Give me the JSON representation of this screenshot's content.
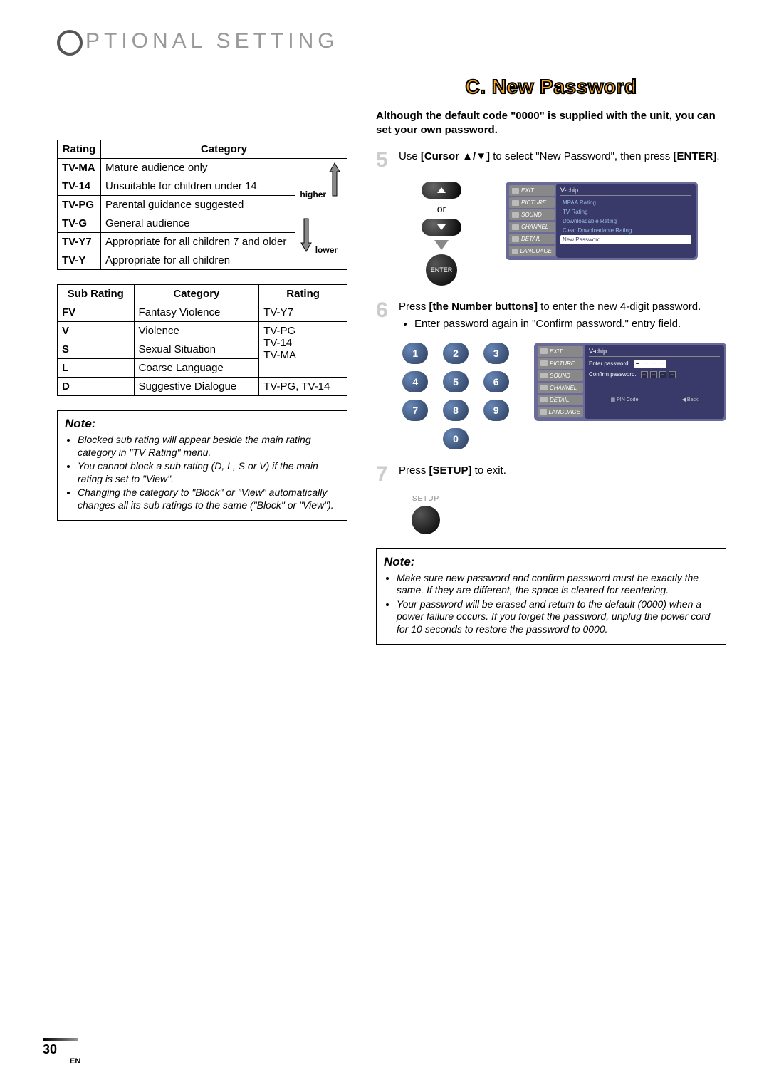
{
  "page_title": "PTIONAL SETTING",
  "section_header": "C. New Password",
  "intro": "Although the default code \"0000\" is supplied with the unit, you can set your own password.",
  "rating_table": {
    "headers": [
      "Rating",
      "Category"
    ],
    "higher": "higher",
    "lower": "lower",
    "rows": [
      {
        "rating": "TV-MA",
        "cat": "Mature audience only"
      },
      {
        "rating": "TV-14",
        "cat": "Unsuitable for children under 14"
      },
      {
        "rating": "TV-PG",
        "cat": "Parental guidance suggested"
      },
      {
        "rating": "TV-G",
        "cat": "General audience"
      },
      {
        "rating": "TV-Y7",
        "cat": "Appropriate for all children 7 and older"
      },
      {
        "rating": "TV-Y",
        "cat": "Appropriate for all children"
      }
    ]
  },
  "sub_table": {
    "headers": [
      "Sub Rating",
      "Category",
      "Rating"
    ],
    "rows": [
      {
        "sr": "FV",
        "cat": "Fantasy Violence",
        "rating": "TV-Y7"
      },
      {
        "sr": "V",
        "cat": "Violence",
        "rating": ""
      },
      {
        "sr": "S",
        "cat": "Sexual Situation",
        "rating": ""
      },
      {
        "sr": "L",
        "cat": "Coarse Language",
        "rating": ""
      },
      {
        "sr": "D",
        "cat": "Suggestive Dialogue",
        "rating": "TV-PG, TV-14"
      }
    ],
    "merged_rating": "TV-PG\nTV-14\nTV-MA"
  },
  "note_left": {
    "title": "Note:",
    "items": [
      "Blocked sub rating will appear beside the main rating category in \"TV Rating\" menu.",
      "You cannot block a sub rating (D, L, S or V) if the main rating is set to \"View\".",
      "Changing the category to \"Block\" or \"View\" automatically changes all its sub ratings to the same (\"Block\" or \"View\")."
    ]
  },
  "steps": {
    "s5": {
      "num": "5",
      "text_pre": "Use ",
      "bold1": "[Cursor ▲/▼]",
      "text_mid": " to select \"New Password\", then press ",
      "bold2": "[ENTER]",
      "text_post": "."
    },
    "s6": {
      "num": "6",
      "text_pre": "Press ",
      "bold1": "[the Number buttons]",
      "text_post": " to enter the new 4-digit password.",
      "bullet": "Enter password again in \"Confirm password.\" entry field."
    },
    "s7": {
      "num": "7",
      "text_pre": "Press ",
      "bold1": "[SETUP]",
      "text_post": " to exit."
    }
  },
  "remote": {
    "or": "or",
    "enter": "ENTER",
    "setup": "SETUP"
  },
  "osd1": {
    "title": "V-chip",
    "side": [
      "EXIT",
      "PICTURE",
      "SOUND",
      "CHANNEL",
      "DETAIL",
      "LANGUAGE"
    ],
    "items": [
      "MPAA Rating",
      "TV Rating",
      "Downloadable Rating",
      "Clear Downloadable Rating",
      "New Password"
    ]
  },
  "osd2": {
    "title": "V-chip",
    "enter_label": "Enter password.",
    "confirm_label": "Confirm password.",
    "footer_pin": "PIN Code",
    "footer_back": "Back"
  },
  "numpad": [
    "1",
    "2",
    "3",
    "4",
    "5",
    "6",
    "7",
    "8",
    "9",
    "0"
  ],
  "note_right": {
    "title": "Note:",
    "items": [
      "Make sure new password and confirm password must be exactly the same. If they are different, the space is cleared for reentering.",
      "Your password will be erased and return to the default (0000) when a power failure occurs. If you forget the password, unplug the power cord for 10 seconds to restore the password to 0000."
    ]
  },
  "page_number": "30",
  "lang": "EN"
}
